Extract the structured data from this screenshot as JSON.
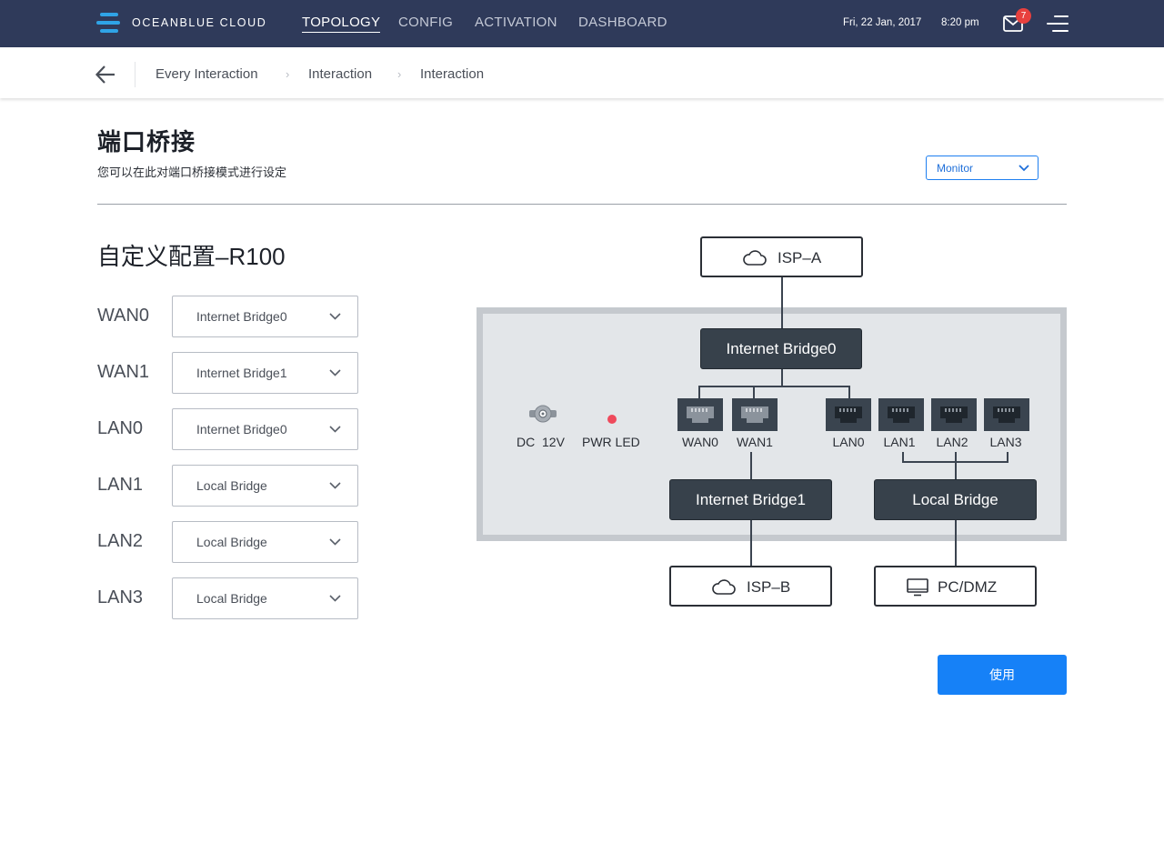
{
  "header": {
    "brand": "OCEANBLUE CLOUD",
    "nav": [
      {
        "label": "TOPOLOGY",
        "active": true
      },
      {
        "label": "CONFIG",
        "active": false
      },
      {
        "label": "ACTIVATION",
        "active": false
      },
      {
        "label": "DASHBOARD",
        "active": false
      }
    ],
    "date": "Fri, 22 Jan, 2017",
    "time": "8:20 pm",
    "mail_count": "7",
    "accent_color": "#2fa3e6",
    "bar_color": "#2f3a5a"
  },
  "breadcrumb": {
    "back_icon": "arrow-left-icon",
    "items": [
      "Every Interaction",
      "Interaction",
      "Interaction"
    ]
  },
  "page": {
    "title": "端口桥接",
    "subtitle": "您可以在此对端口桥接模式进行设定",
    "mode": {
      "selected": "Monitor"
    }
  },
  "config": {
    "title": "自定义配置–R100",
    "ports": [
      {
        "label": "WAN0",
        "value": "Internet Bridge0"
      },
      {
        "label": "WAN1",
        "value": "Internet Bridge1"
      },
      {
        "label": "LAN0",
        "value": "Internet Bridge0"
      },
      {
        "label": "LAN1",
        "value": "Local Bridge"
      },
      {
        "label": "LAN2",
        "value": "Local Bridge"
      },
      {
        "label": "LAN3",
        "value": "Local Bridge"
      }
    ]
  },
  "diagram": {
    "isp_a": "ISP–A",
    "isp_b": "ISP–B",
    "pc": "PC/DMZ",
    "bridge0": "Internet Bridge0",
    "bridge1": "Internet Bridge1",
    "local_bridge": "Local Bridge",
    "dc_label": "DC  12V",
    "pwr_label": "PWR LED",
    "ports": [
      "WAN0",
      "WAN1",
      "LAN0",
      "LAN1",
      "LAN2",
      "LAN3"
    ],
    "led_color": "#ef4a5c"
  },
  "actions": {
    "apply": "使用",
    "apply_color": "#1681f7"
  }
}
